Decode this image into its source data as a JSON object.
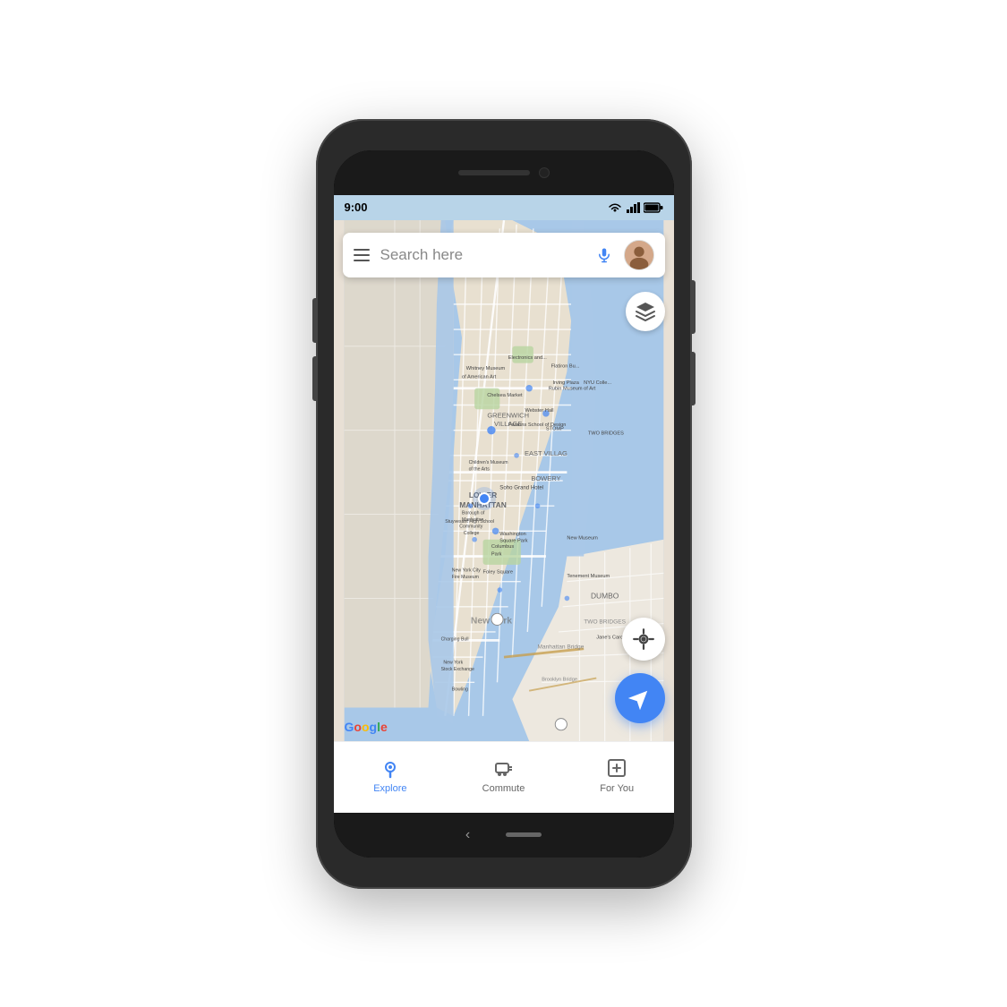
{
  "phone": {
    "status_bar": {
      "time": "9:00",
      "wifi": true,
      "signal_bars": 3,
      "battery": "full"
    },
    "search_bar": {
      "placeholder": "Search here",
      "hamburger_label": "Menu",
      "mic_label": "Voice search",
      "avatar_label": "User account"
    },
    "map": {
      "location_name": "New York",
      "layers_label": "Map layers",
      "location_btn_label": "My location",
      "navigate_fab_label": "Navigate"
    },
    "google_logo": "Google",
    "bottom_nav": {
      "items": [
        {
          "id": "explore",
          "label": "Explore",
          "active": true
        },
        {
          "id": "commute",
          "label": "Commute",
          "active": false
        },
        {
          "id": "for-you",
          "label": "For You",
          "active": false
        }
      ]
    },
    "system_nav": {
      "back": "‹"
    }
  }
}
